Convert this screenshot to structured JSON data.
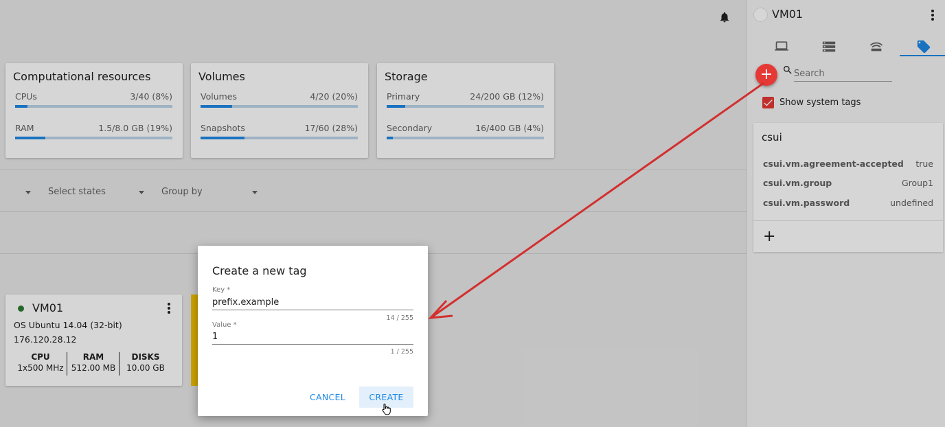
{
  "header": {
    "notification_icon": "bell-icon"
  },
  "resources": {
    "computational": {
      "title": "Computational resources",
      "cpus": {
        "label": "CPUs",
        "value": "3/40 (8%)",
        "fraction": 0.08
      },
      "ram": {
        "label": "RAM",
        "value": "1.5/8.0 GB (19%)",
        "fraction": 0.19
      }
    },
    "volumes": {
      "title": "Volumes",
      "volumes": {
        "label": "Volumes",
        "value": "4/20 (20%)",
        "fraction": 0.2
      },
      "snapshots": {
        "label": "Snapshots",
        "value": "17/60 (28%)",
        "fraction": 0.28
      }
    },
    "storage": {
      "title": "Storage",
      "primary": {
        "label": "Primary",
        "value": "24/200 GB (12%)",
        "fraction": 0.12
      },
      "secondary": {
        "label": "Secondary",
        "value": "16/400 GB (4%)",
        "fraction": 0.04
      }
    }
  },
  "filters": {
    "states_placeholder": "Select states",
    "group_by_placeholder": "Group by"
  },
  "vm_card": {
    "name": "VM01",
    "status_color": "#2e7d32",
    "os": "OS Ubuntu 14.04 (32-bit)",
    "ip": "176.120.28.12",
    "specs": [
      {
        "label": "CPU",
        "value": "1x500 MHz"
      },
      {
        "label": "RAM",
        "value": "512.00 MB"
      },
      {
        "label": "DISKS",
        "value": "10.00 GB"
      }
    ]
  },
  "sidebar": {
    "title": "VM01",
    "tabs": [
      "laptop-icon",
      "storage-icon",
      "network-icon",
      "tag-icon"
    ],
    "active_tab": 3,
    "search_placeholder": "Search",
    "show_system_tags": {
      "label": "Show system tags",
      "checked": true
    },
    "tag_group": {
      "name": "csui",
      "tags": [
        {
          "key": "csui.vm.agreement-accepted",
          "value": "true"
        },
        {
          "key": "csui.vm.group",
          "value": "Group1"
        },
        {
          "key": "csui.vm.password",
          "value": "undefined"
        }
      ],
      "add_label": "+"
    },
    "fab_label": "+"
  },
  "dialog": {
    "title": "Create a new tag",
    "key": {
      "label": "Key *",
      "value": "prefix.example",
      "counter": "14 / 255"
    },
    "value": {
      "label": "Value *",
      "value": "1",
      "counter": "1 / 255"
    },
    "cancel_label": "CANCEL",
    "create_label": "CREATE"
  },
  "colors": {
    "accent": "#1e88e5",
    "danger": "#e53935",
    "annotation": "#d32f2f"
  }
}
